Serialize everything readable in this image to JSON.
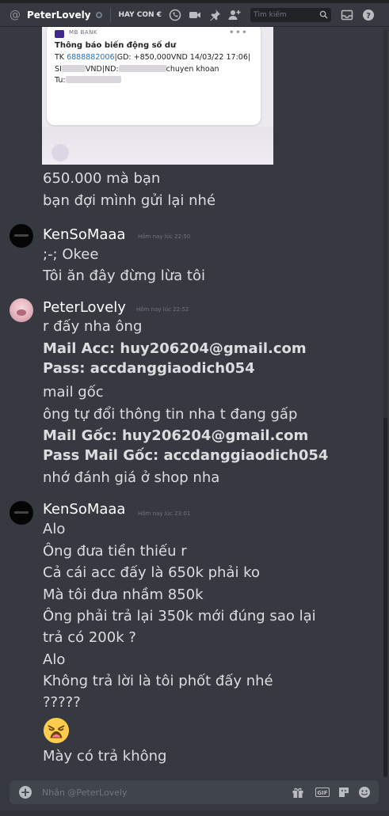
{
  "header": {
    "dm_name": "PeterLovely",
    "channel": "HAY CON €",
    "search_placeholder": "Tìm kiếm"
  },
  "attachment": {
    "bank_label": "MB BANK",
    "title": "Thông báo biến động số dư",
    "line1_prefix": "TK ",
    "line1_account": "6888882006",
    "line1_rest": "|GD: +850,000VND 14/03/22 17:06|",
    "line2_a": "SI",
    "line2_b": "VND|ND:",
    "line2_c": "chuyen khoan",
    "line3": "Tu:"
  },
  "messages": {
    "m0": [
      "650.000 mà bạn",
      "bạn đợi mình gửi lại nhé"
    ],
    "g1": {
      "author": "KenSoMaaa",
      "time": "Hôm nay lúc 22:50",
      "lines": [
        ";-; Okee",
        "Tôi ăn đây đừng lừa tôi"
      ]
    },
    "g2": {
      "author": "PeterLovely",
      "time": "Hôm nay lúc 22:52",
      "lines": [
        "r đấy nha ông",
        "Mail Acc: huy206204@gmail.com",
        "Pass: accdanggiaodich054",
        "mail gốc",
        "ông tự đổi thông tin nha t đang gấp",
        "Mail Gốc: huy206204@gmail.com",
        "Pass Mail Gốc: accdanggiaodich054",
        "nhớ đánh giá ở shop nha"
      ]
    },
    "g3": {
      "author": "KenSoMaaa",
      "time": "Hôm nay lúc 23:01",
      "lines": [
        "Alo",
        "Ông đưa tiền thiếu r",
        "Cả cái acc đấy là 650k phải ko",
        "Mà tôi đưa nhầm 850k",
        "Ông phải trả lại 350k mới đúng sao lại",
        "trả có 200k ?",
        "Alo",
        "Không trả lời là tôi phốt đấy nhé",
        "?????",
        "Mày có trả không"
      ],
      "emoji": "weary-face"
    }
  },
  "composer": {
    "placeholder": "Nhắn @PeterLovely",
    "gif_label": "GIF"
  },
  "colors": {
    "background": "#36393f",
    "accent_blue": "#1a73c8",
    "text": "#dcddde"
  }
}
